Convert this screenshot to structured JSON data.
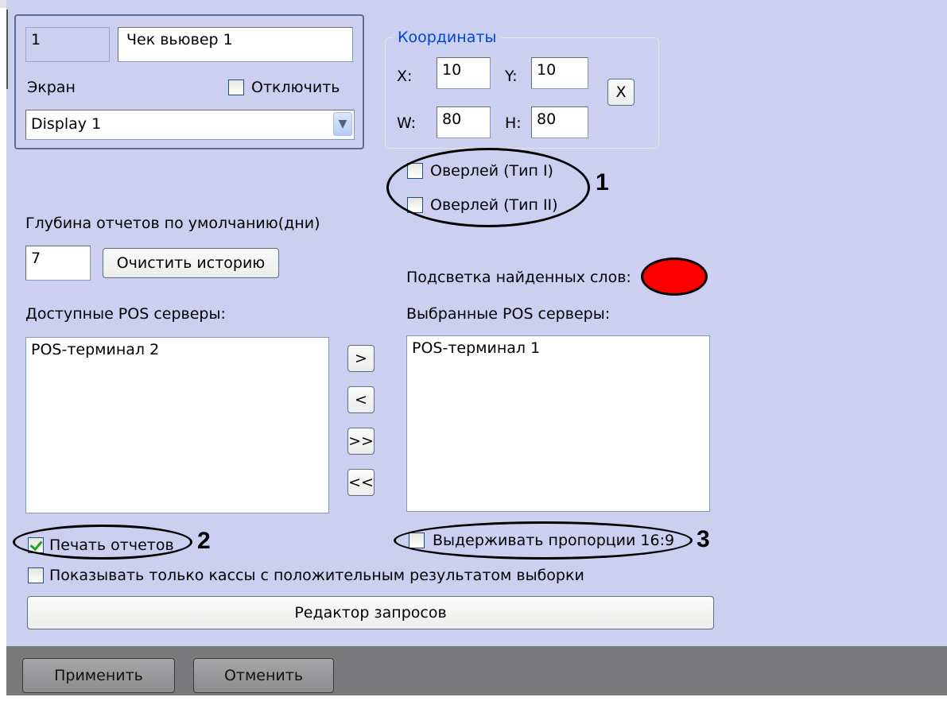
{
  "camera": {
    "number": "1",
    "name": "Чек вьювер 1"
  },
  "screen": {
    "label": "Экран",
    "disable_label": "Отключить",
    "display_value": "Display 1"
  },
  "coordinates": {
    "title": "Координаты",
    "x_label": "X:",
    "x_value": "10",
    "y_label": "Y:",
    "y_value": "10",
    "w_label": "W:",
    "w_value": "80",
    "h_label": "H:",
    "h_value": "80",
    "reset_label": "X"
  },
  "overlay": {
    "type1_label": "Оверлей (Тип I)",
    "type2_label": "Оверлей (Тип II)"
  },
  "reports": {
    "depth_label": "Глубина отчетов по умолчанию(дни)",
    "depth_value": "7",
    "clear_history_label": "Очистить историю"
  },
  "highlight": {
    "label": "Подсветка найденных слов:",
    "color": "#ff0000"
  },
  "servers": {
    "available_label": "Доступные POS серверы:",
    "available_items": [
      "POS-терминал 2"
    ],
    "selected_label": "Выбранные POS серверы:",
    "selected_items": [
      "POS-терминал 1"
    ],
    "move_right": ">",
    "move_left": "<",
    "move_all_right": ">>",
    "move_all_left": "<<"
  },
  "options": {
    "print_reports_label": "Печать отчетов",
    "print_reports_checked": true,
    "keep_ratio_label": "Выдерживать пропорции 16:9",
    "keep_ratio_checked": false,
    "show_positive_label": "Показывать только кассы с положительным результатом выборки",
    "show_positive_checked": false
  },
  "query_editor_label": "Редактор запросов",
  "footer": {
    "apply_label": "Применить",
    "cancel_label": "Отменить"
  },
  "markers": {
    "m1": "1",
    "m2": "2",
    "m3": "3"
  }
}
